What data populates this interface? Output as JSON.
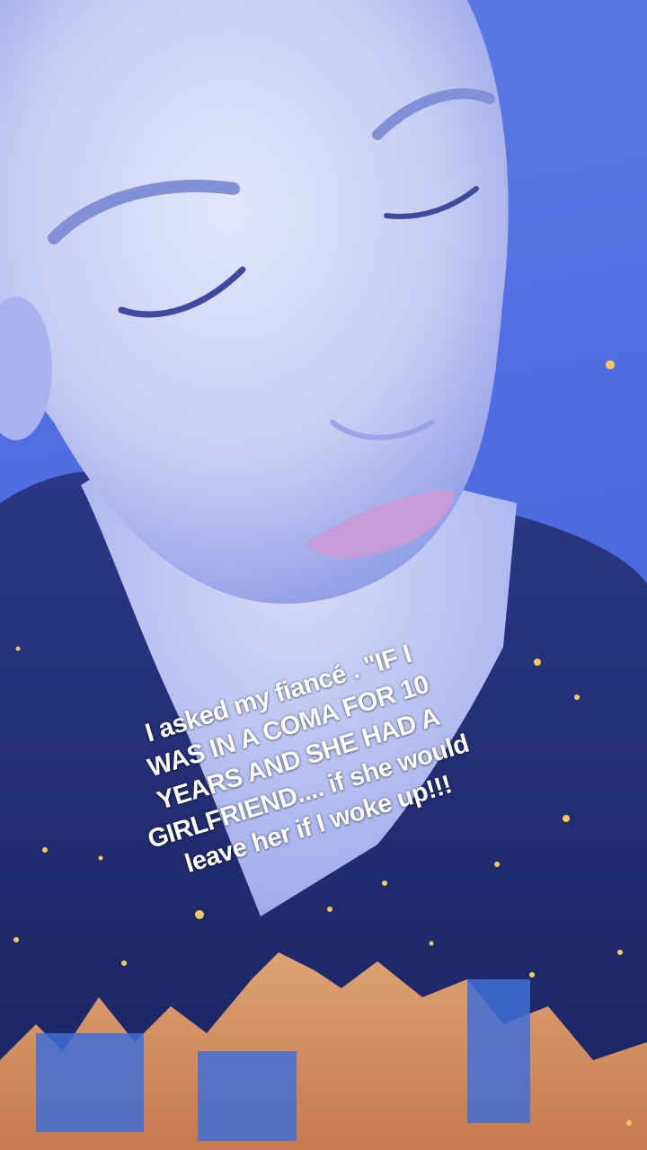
{
  "video": {
    "overlay_caption": "I asked my fiancé . \"IF I\nWAS IN A COMA FOR 10\nYEARS AND SHE HAD A\nGIRLFRIEND.... if she would\nleave her if I woke up!!!",
    "filter_effect": "blue-tint-sparkle-filter",
    "colors": {
      "background": "#4f6de0",
      "skin_tint": "#c9d0f4",
      "shirt": "#1f2a6b",
      "flame": "#e89a5c",
      "sparkle": "#f5c95a",
      "caption_text": "#ffffff"
    }
  }
}
